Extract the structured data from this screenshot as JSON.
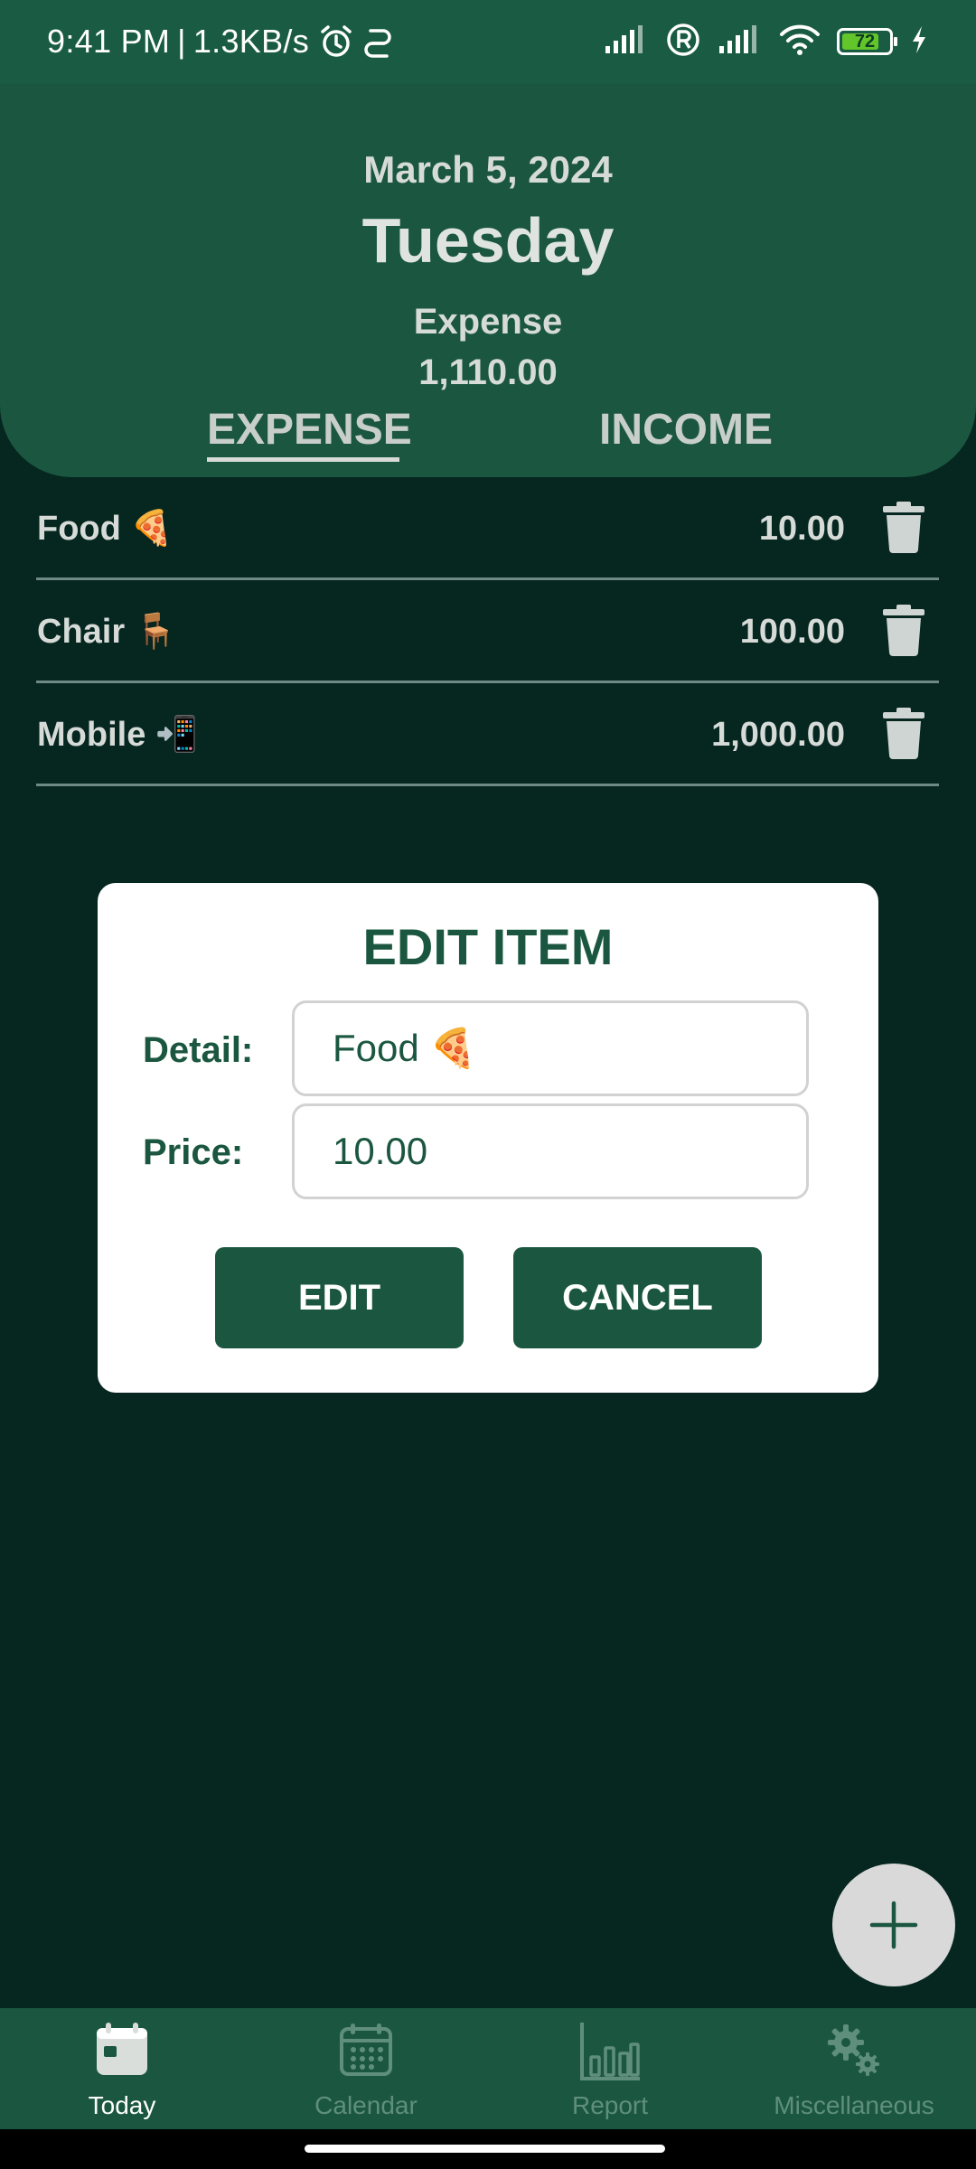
{
  "status_bar": {
    "time": "9:41 PM",
    "separator": "|",
    "net_speed": "1.3KB/s",
    "battery_level": "72",
    "icons": [
      "alarm-icon",
      "data-saver-icon",
      "signal-icon",
      "roaming-icon",
      "signal-icon",
      "wifi-icon",
      "battery-icon",
      "charging-icon"
    ]
  },
  "header": {
    "date": "March 5, 2024",
    "day": "Tuesday",
    "summary_label": "Expense",
    "summary_value": "1,110.00",
    "tabs": [
      {
        "label": "EXPENSE",
        "active": true
      },
      {
        "label": "INCOME",
        "active": false
      }
    ]
  },
  "items": [
    {
      "detail": "Food 🍕",
      "amount": "10.00"
    },
    {
      "detail": "Chair 🪑",
      "amount": "100.00"
    },
    {
      "detail": "Mobile 📲",
      "amount": "1,000.00"
    }
  ],
  "dialog": {
    "title": "EDIT ITEM",
    "detail_label": "Detail:",
    "detail_value": "Food 🍕",
    "price_label": "Price:",
    "price_value": "10.00",
    "edit_label": "EDIT",
    "cancel_label": "CANCEL"
  },
  "fab": {
    "icon": "plus-icon"
  },
  "nav": [
    {
      "label": "Today",
      "icon": "calendar-today-icon",
      "active": true
    },
    {
      "label": "Calendar",
      "icon": "calendar-month-icon",
      "active": false
    },
    {
      "label": "Report",
      "icon": "bar-chart-icon",
      "active": false
    },
    {
      "label": "Miscellaneous",
      "icon": "gears-icon",
      "active": false
    }
  ],
  "colors": {
    "primary": "#1b5740",
    "background": "#062620",
    "status_bar": "#1a5c43",
    "dialog": "#ffffff"
  }
}
